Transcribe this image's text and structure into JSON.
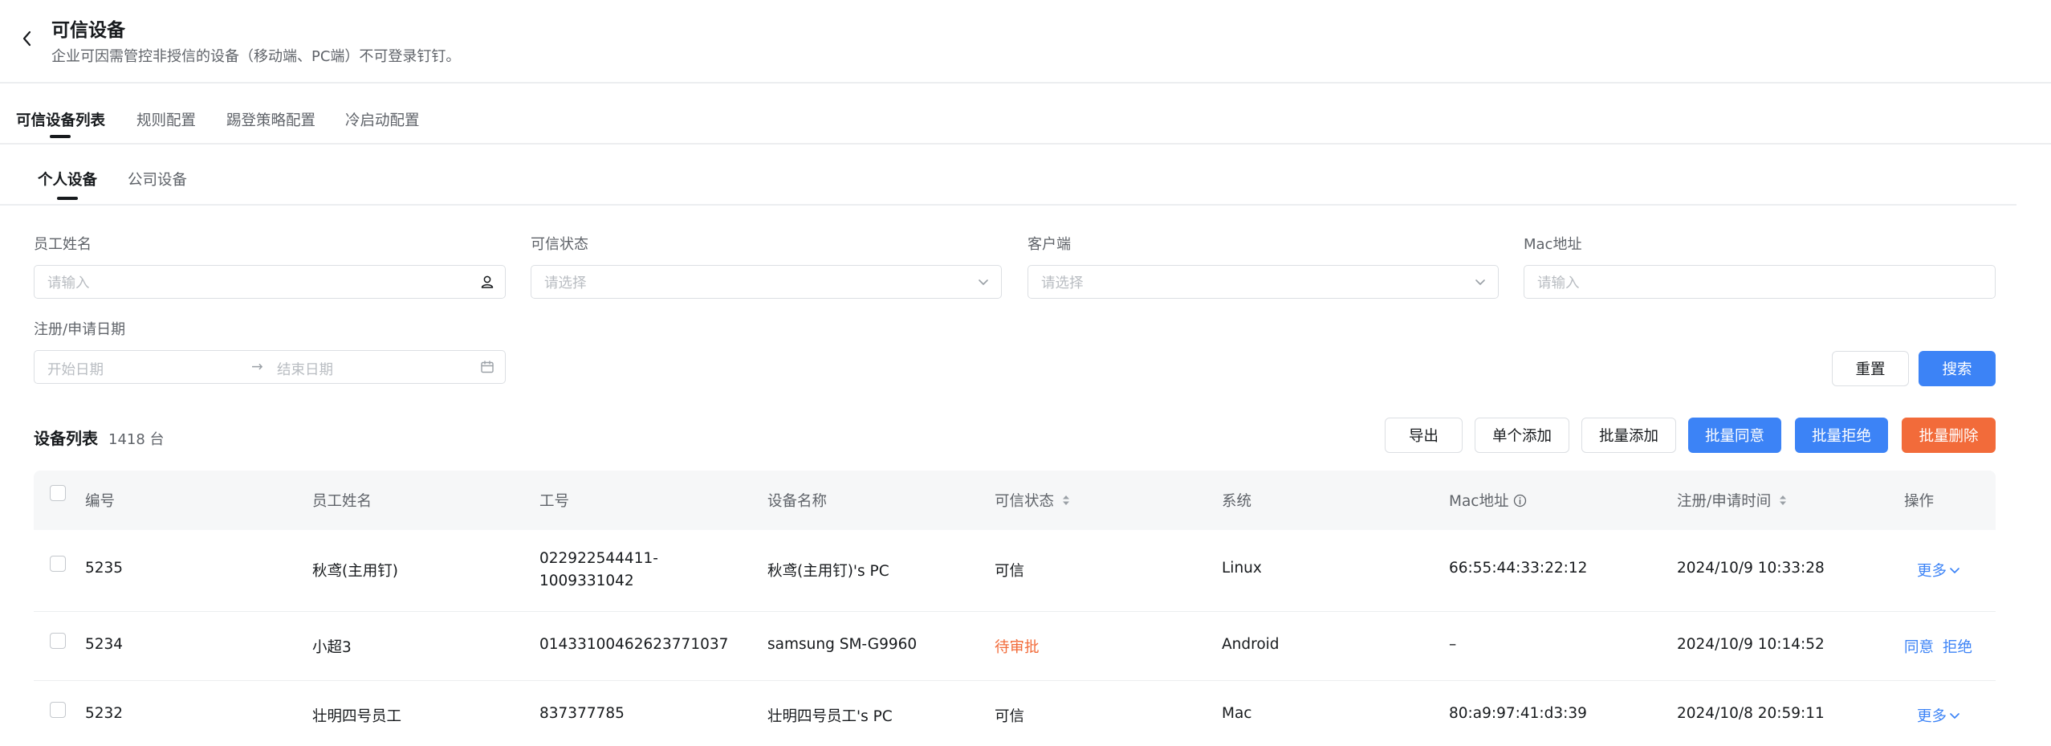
{
  "header": {
    "title": "可信设备",
    "subtitle": "企业可因需管控非授信的设备（移动端、PC端）不可登录钉钉。"
  },
  "main_tabs": [
    {
      "label": "可信设备列表",
      "active": true
    },
    {
      "label": "规则配置",
      "active": false
    },
    {
      "label": "踢登策略配置",
      "active": false
    },
    {
      "label": "冷启动配置",
      "active": false
    }
  ],
  "sub_tabs": [
    {
      "label": "个人设备",
      "active": true
    },
    {
      "label": "公司设备",
      "active": false
    }
  ],
  "filters": {
    "employee_name": {
      "label": "员工姓名",
      "placeholder": "请输入"
    },
    "trust_status": {
      "label": "可信状态",
      "placeholder": "请选择"
    },
    "client": {
      "label": "客户端",
      "placeholder": "请选择"
    },
    "mac": {
      "label": "Mac地址",
      "placeholder": "请输入"
    },
    "date": {
      "label": "注册/申请日期",
      "start_placeholder": "开始日期",
      "end_placeholder": "结束日期",
      "separator": "→"
    }
  },
  "filter_actions": {
    "reset": "重置",
    "search": "搜索"
  },
  "list": {
    "title": "设备列表",
    "count": "1418 台"
  },
  "toolbar": {
    "export": "导出",
    "single_add": "单个添加",
    "batch_add": "批量添加",
    "batch_approve": "批量同意",
    "batch_reject": "批量拒绝",
    "batch_delete": "批量删除"
  },
  "colors": {
    "primary": "#3c83f6",
    "danger": "#f26b3a",
    "text": "#171a1d",
    "secondary": "#5f6369"
  },
  "table": {
    "headers": {
      "id": "编号",
      "name": "员工姓名",
      "job_no": "工号",
      "device_name": "设备名称",
      "status": "可信状态",
      "os": "系统",
      "mac": "Mac地址",
      "time": "注册/申请时间",
      "action": "操作"
    },
    "rows": [
      {
        "id": "5235",
        "name": "秋鸢(主用钉)",
        "job_no": "022922544411-1009331042",
        "device_name": "秋鸢(主用钉)'s PC",
        "status": "可信",
        "os": "Linux",
        "mac": "66:55:44:33:22:12",
        "time": "2024/10/9 10:33:28",
        "action_more": "更多"
      },
      {
        "id": "5234",
        "name": "小超3",
        "job_no": "01433100462623771037",
        "device_name": "samsung SM-G9960",
        "status": "待审批",
        "os": "Android",
        "mac": "–",
        "time": "2024/10/9 10:14:52",
        "action_approve": "同意",
        "action_reject": "拒绝"
      },
      {
        "id": "5232",
        "name": "壮明四号员工",
        "job_no": "837377785",
        "device_name": "壮明四号员工's PC",
        "status": "可信",
        "os": "Mac",
        "mac": "80:a9:97:41:d3:39",
        "time": "2024/10/8 20:59:11",
        "action_more": "更多"
      }
    ]
  }
}
